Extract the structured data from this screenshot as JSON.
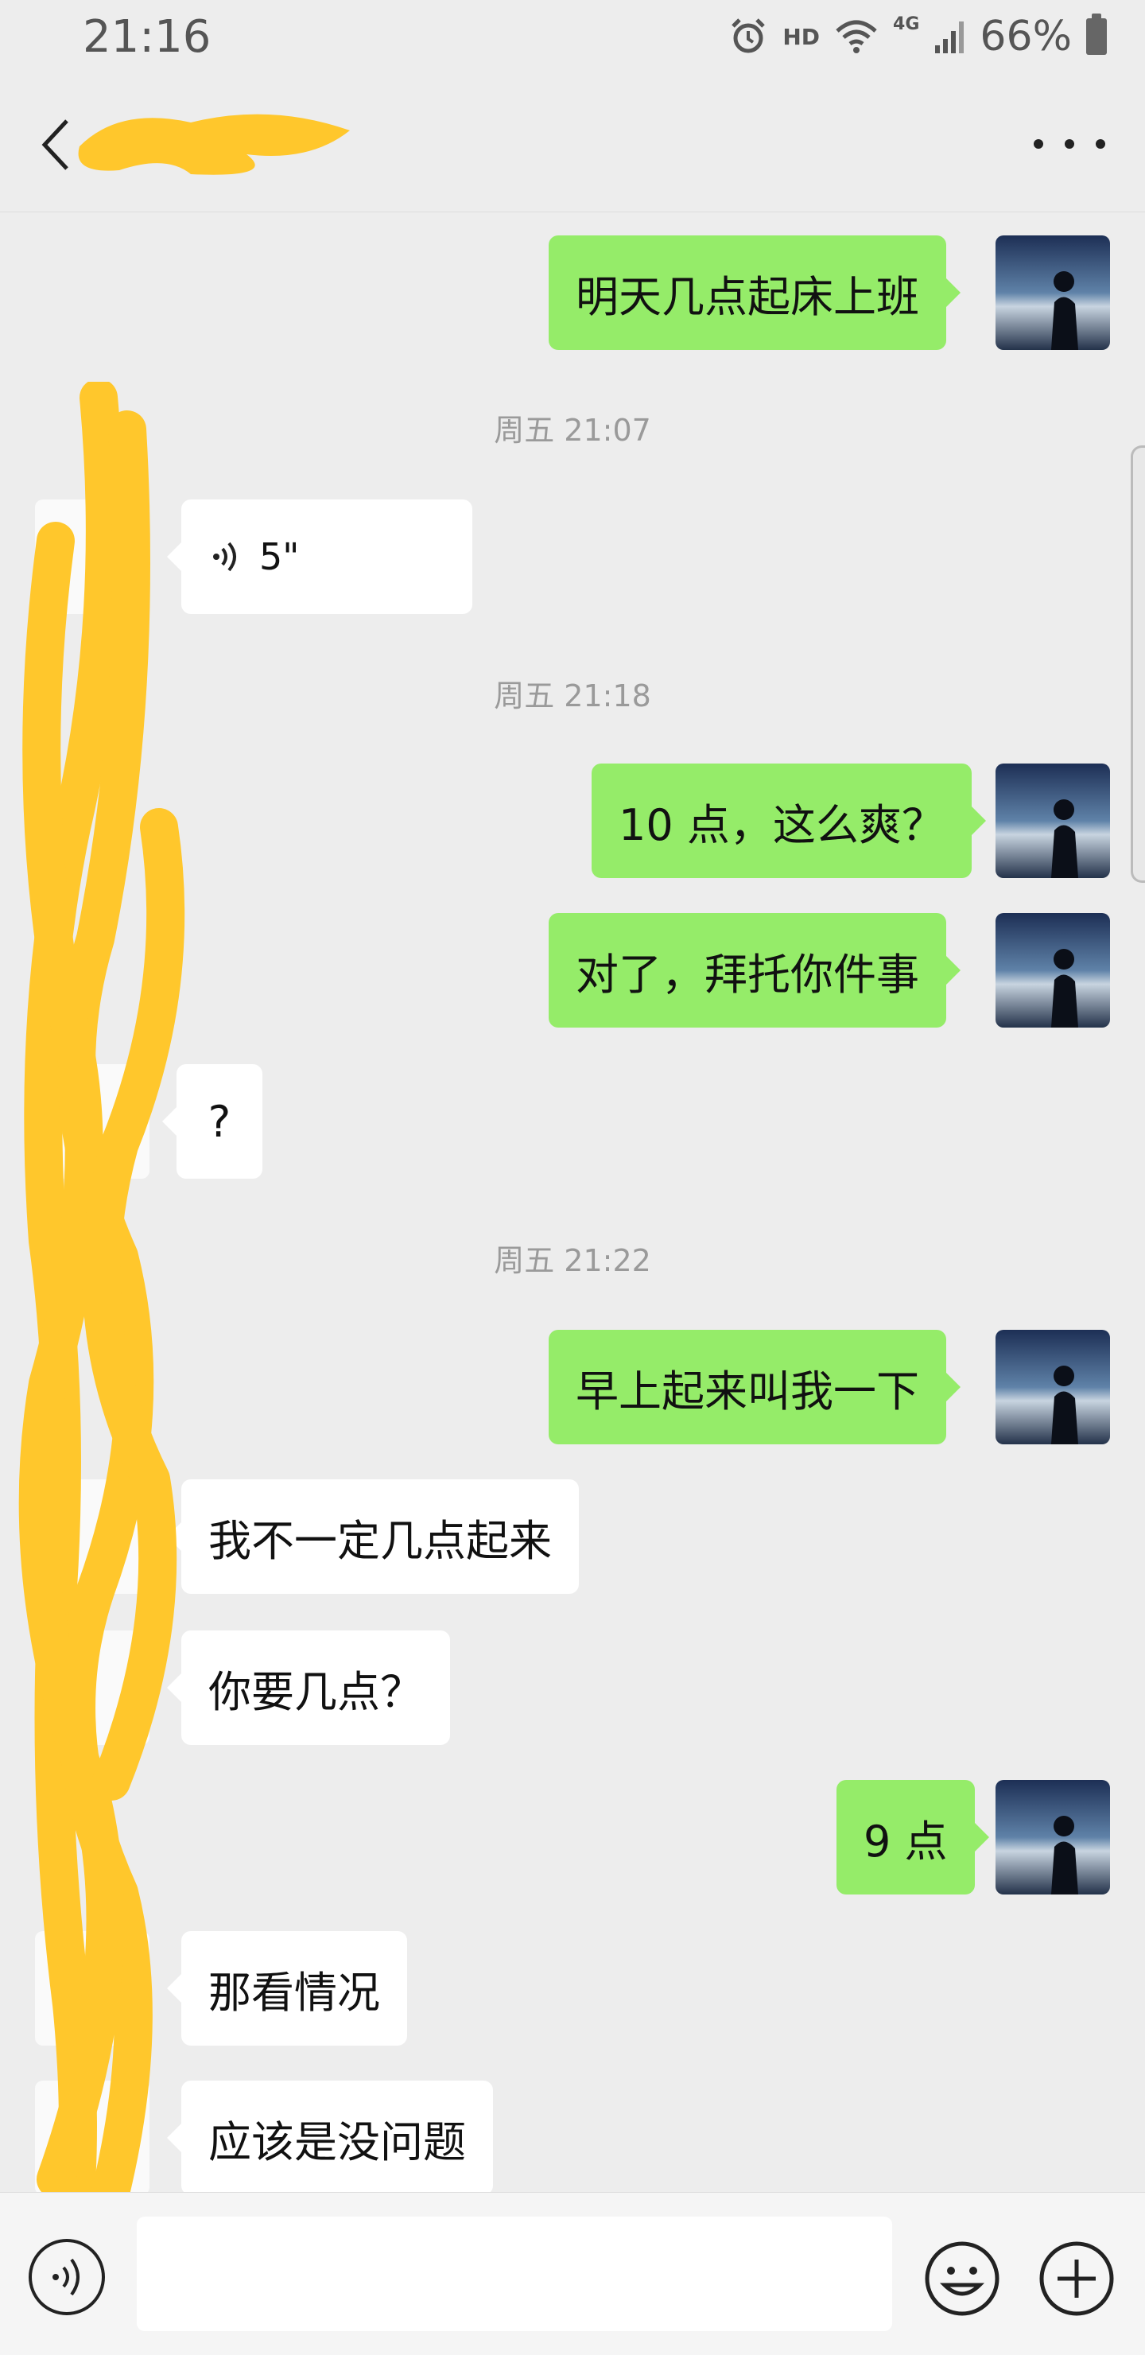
{
  "status_bar": {
    "time": "21:16",
    "hd": "HD",
    "network": "4G",
    "battery": "66%"
  },
  "messages": [
    {
      "type": "text",
      "side": "me",
      "text": "明天几点起床上班"
    },
    {
      "type": "time",
      "text": "周五 21:07"
    },
    {
      "type": "voice",
      "side": "them",
      "text": "5\""
    },
    {
      "type": "time",
      "text": "周五 21:18"
    },
    {
      "type": "text",
      "side": "me",
      "text": "10 点，这么爽？"
    },
    {
      "type": "text",
      "side": "me",
      "text": "对了，拜托你件事"
    },
    {
      "type": "text",
      "side": "them",
      "text": "?"
    },
    {
      "type": "time",
      "text": "周五 21:22"
    },
    {
      "type": "text",
      "side": "me",
      "text": "早上起来叫我一下"
    },
    {
      "type": "text",
      "side": "them",
      "text": "我不一定几点起来"
    },
    {
      "type": "text",
      "side": "them",
      "text": "你要几点？"
    },
    {
      "type": "text",
      "side": "me",
      "text": "9 点"
    },
    {
      "type": "text",
      "side": "them",
      "text": "那看情况"
    },
    {
      "type": "text",
      "side": "them",
      "text": "应该是没问题"
    }
  ],
  "input": {
    "value": ""
  },
  "colors": {
    "background": "#ededed",
    "my_bubble": "#95ec69",
    "their_bubble": "#ffffff",
    "redaction": "#ffc72c"
  },
  "icons": {
    "back": "chevron-left-icon",
    "more": "more-dots-icon",
    "voice_input": "voice-input-icon",
    "emoji": "emoji-icon",
    "plus": "plus-icon"
  }
}
